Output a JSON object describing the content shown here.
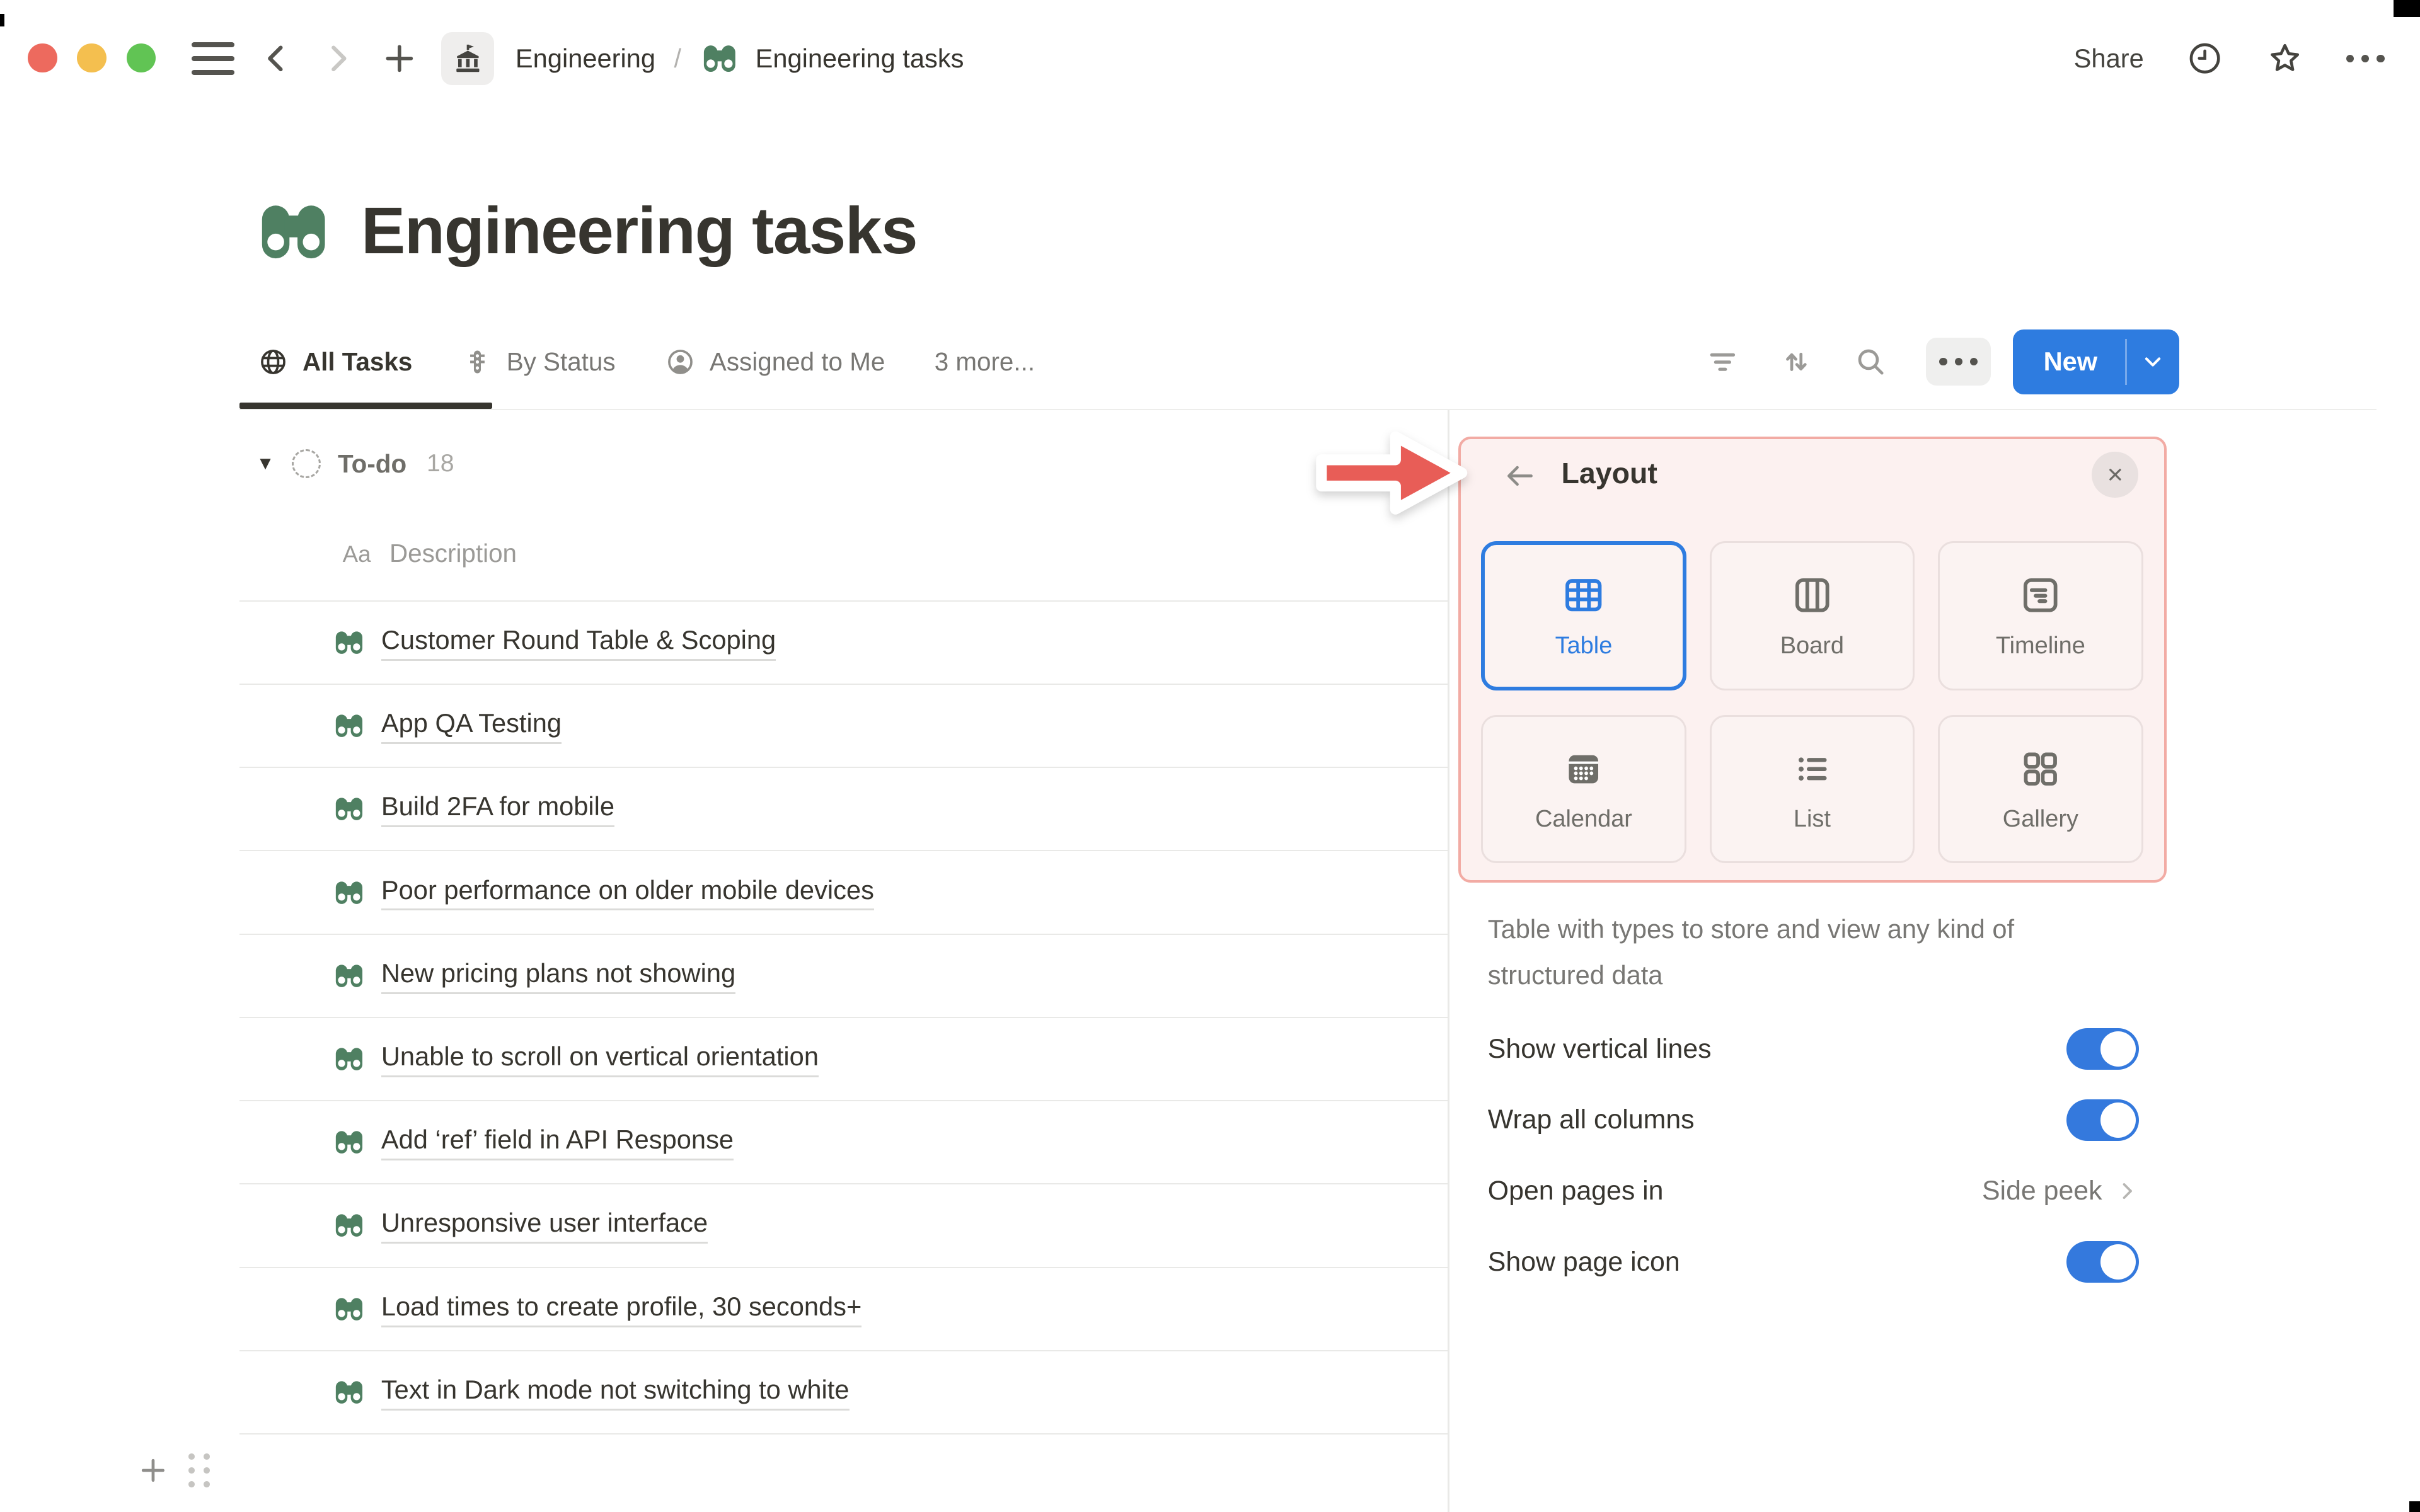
{
  "topbar": {
    "traffic_lights": [
      "close",
      "minimize",
      "fullscreen"
    ],
    "breadcrumb": {
      "space": "Engineering",
      "separator": "/",
      "page": "Engineering tasks"
    },
    "share_label": "Share",
    "icons": [
      "sidebar-menu-icon",
      "back-icon",
      "forward-icon",
      "new-page-icon",
      "teamspace-building-icon",
      "clock-icon",
      "star-icon",
      "more-icon"
    ]
  },
  "page": {
    "title": "Engineering tasks",
    "icon": "binoculars-icon"
  },
  "view_tabs": [
    {
      "label": "All Tasks",
      "icon": "globe-icon",
      "active": true
    },
    {
      "label": "By Status",
      "icon": "status-traffic-light-icon",
      "active": false
    },
    {
      "label": "Assigned to Me",
      "icon": "person-icon",
      "active": false
    },
    {
      "label": "3 more...",
      "icon": "",
      "active": false
    }
  ],
  "view_toolbar": {
    "icons": [
      "filter-icon",
      "sort-icon",
      "search-icon",
      "more-icon"
    ],
    "new_label": "New"
  },
  "table": {
    "group": {
      "disclosure": "▼",
      "name": "To-do",
      "count": "18"
    },
    "column_header": {
      "type_glyph": "Aa",
      "label": "Description"
    },
    "rows": [
      "Customer Round Table & Scoping",
      "App QA Testing",
      "Build 2FA for mobile",
      "Poor performance on older mobile devices",
      "New pricing plans not showing",
      "Unable to scroll on vertical orientation",
      "Add ‘ref’ field in API Response",
      "Unresponsive user interface",
      "Load times to create profile, 30 seconds+",
      "Text in Dark mode not switching to white"
    ]
  },
  "layout_panel": {
    "title": "Layout",
    "options": [
      {
        "label": "Table",
        "icon": "table-layout-icon",
        "selected": true
      },
      {
        "label": "Board",
        "icon": "board-layout-icon",
        "selected": false
      },
      {
        "label": "Timeline",
        "icon": "timeline-layout-icon",
        "selected": false
      },
      {
        "label": "Calendar",
        "icon": "calendar-layout-icon",
        "selected": false
      },
      {
        "label": "List",
        "icon": "list-layout-icon",
        "selected": false
      },
      {
        "label": "Gallery",
        "icon": "gallery-layout-icon",
        "selected": false
      }
    ],
    "description": "Table with types to store and view any kind of structured data",
    "settings": [
      {
        "label": "Show vertical lines",
        "control": "toggle",
        "value": "on"
      },
      {
        "label": "Wrap all columns",
        "control": "toggle",
        "value": "on"
      },
      {
        "label": "Open pages in",
        "control": "link",
        "value": "Side peek"
      },
      {
        "label": "Show page icon",
        "control": "toggle",
        "value": "on"
      }
    ]
  },
  "colors": {
    "accent_blue": "#2e7ce0",
    "toggle_blue": "#3479dd",
    "icon_green": "#4f8062",
    "annotation_red": "#e85d57",
    "panel_tint": "#fcf1f0",
    "panel_border": "#f2aba4",
    "text_dark": "#37352f",
    "text_gray": "#787774",
    "divider": "#e9e9e7"
  }
}
